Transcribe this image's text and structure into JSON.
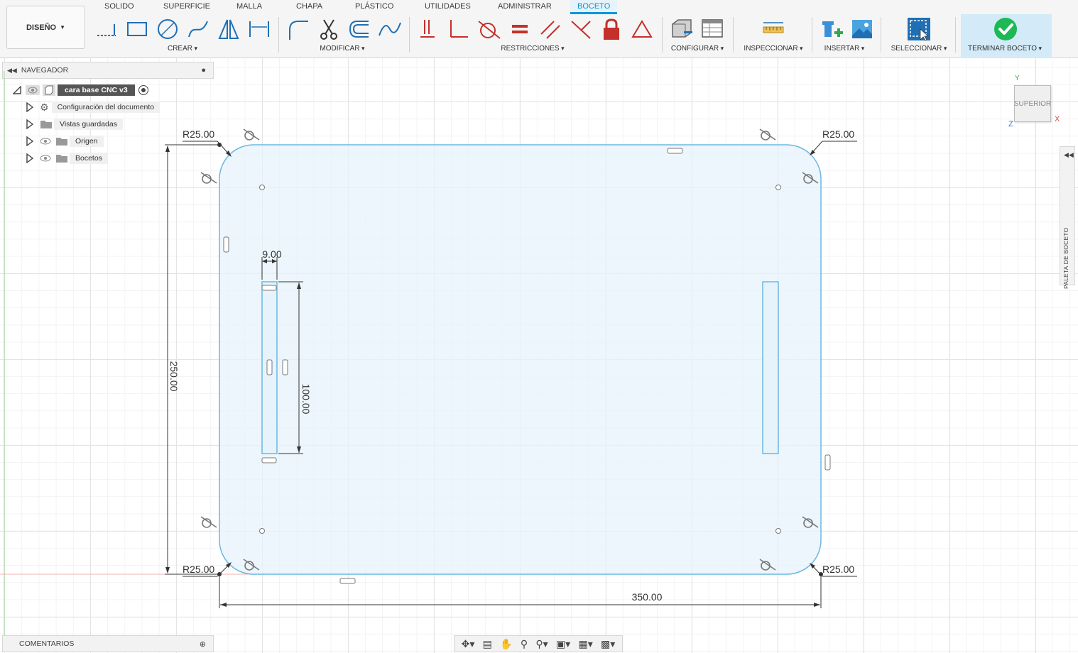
{
  "toolbar": {
    "design_button": "DISEÑO",
    "tabs": [
      "SOLIDO",
      "SUPERFICIE",
      "MALLA",
      "CHAPA",
      "PLÁSTICO",
      "UTILIDADES",
      "ADMINISTRAR",
      "BOCETO"
    ],
    "active_tab": "BOCETO",
    "groups": [
      "CREAR",
      "MODIFICAR",
      "RESTRICCIONES",
      "CONFIGURAR",
      "INSPECCIONAR",
      "INSERTAR",
      "SELECCIONAR",
      "TERMINAR BOCETO"
    ]
  },
  "navigator": {
    "title": "NAVEGADOR",
    "root": "cara base CNC v3",
    "items": [
      "Configuración del documento",
      "Vistas guardadas",
      "Origen",
      "Bocetos"
    ]
  },
  "comments": {
    "label": "COMENTARIOS"
  },
  "viewcube": {
    "face": "SUPERIOR",
    "axis_x": "X",
    "axis_y": "Y",
    "axis_z": "Z"
  },
  "palette": {
    "label": "PALETA DE BOCETO"
  },
  "sketch": {
    "dim_radius_tl": "R25.00",
    "dim_radius_tr": "R25.00",
    "dim_radius_bl": "R25.00",
    "dim_radius_br": "R25.00",
    "dim_width": "350.00",
    "dim_height": "250.00",
    "dim_slot_width": "9.00",
    "dim_slot_height": "100.00"
  },
  "colors": {
    "accent": "#0696d7",
    "finish": "#1db954",
    "profile_fill": "#e6f3fb",
    "profile_stroke": "#6cb7e0",
    "constraint_red": "#c4302b"
  }
}
